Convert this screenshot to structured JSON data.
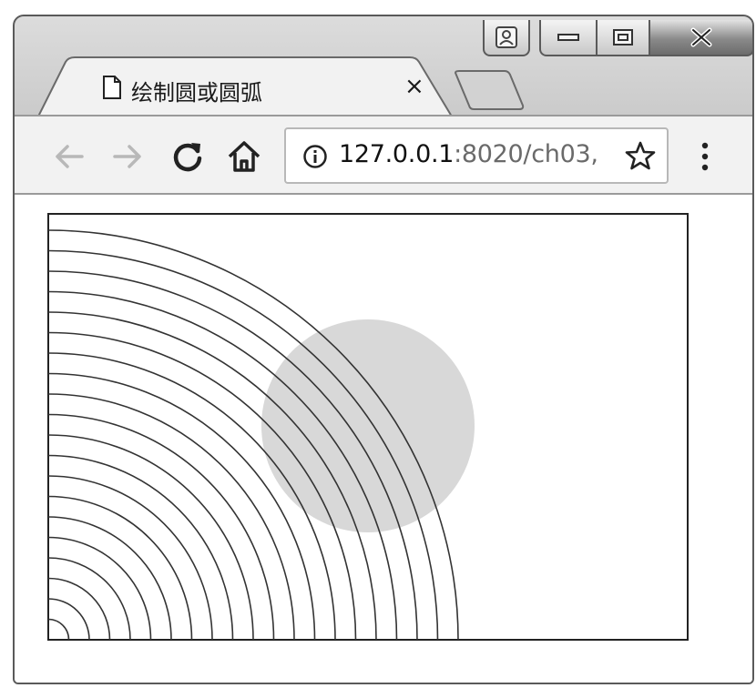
{
  "window": {
    "controls": [
      "user-icon",
      "minimize-icon",
      "maximize-icon",
      "close-icon"
    ]
  },
  "tab": {
    "title": "绘制圆或圆弧",
    "close_label": "×",
    "icon": "document-icon"
  },
  "toolbar": {
    "back_icon": "arrow-left-icon",
    "forward_icon": "arrow-right-icon",
    "reload_icon": "reload-icon",
    "home_icon": "home-icon",
    "menu_icon": "vertical-dots-icon"
  },
  "address_bar": {
    "host": "127.0.0.1",
    "rest": ":8020/ch03,",
    "info_icon": "info-icon",
    "bookmark_icon": "star-icon"
  },
  "canvas": {
    "arcs": {
      "count": 20,
      "radius_step": 22.5,
      "stroke_color": "#333333"
    },
    "circle": {
      "fill_color": "#d8d8d8"
    }
  },
  "colors": {
    "frame_border": "#5a5a5a",
    "toolbar_bg": "#f2f2f2",
    "icon_disabled": "#b8b8b8",
    "icon_enabled": "#222222"
  }
}
